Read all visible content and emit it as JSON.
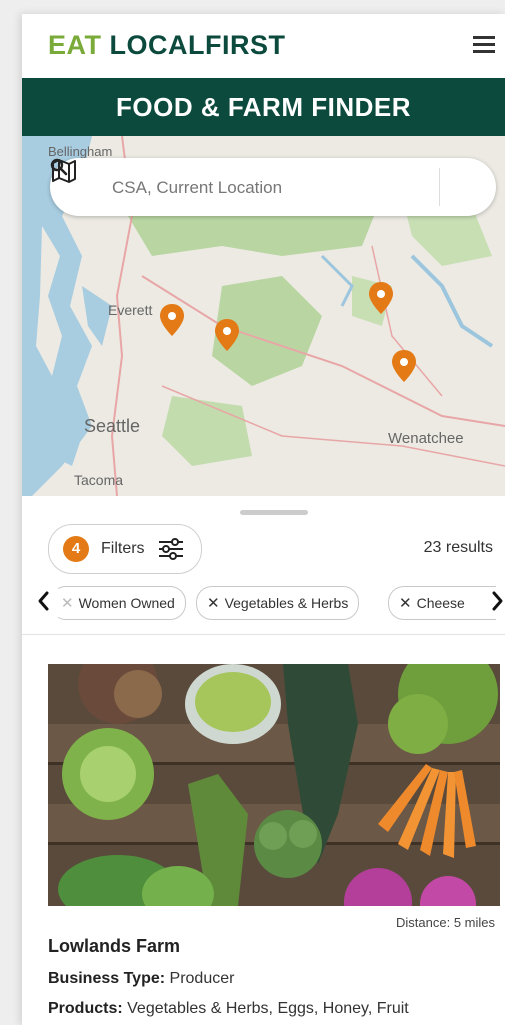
{
  "header": {
    "logo": {
      "eat": "EAT",
      "local": "LOCAL",
      "first": "FIRST"
    },
    "menu_icon": "hamburger-icon",
    "banner_title": "FOOD & FARM FINDER"
  },
  "map": {
    "search_placeholder": "CSA, Current Location",
    "search_icon": "search-icon",
    "map_toggle_icon": "map-icon",
    "place_labels": [
      "Bellingham",
      "Everett",
      "Seattle",
      "Tacoma",
      "Wenatchee"
    ],
    "marker_color": "#e37a16"
  },
  "panel": {
    "filters_count": "4",
    "filters_label": "Filters",
    "results": "23 results",
    "chips": [
      {
        "label": "Women Owned"
      },
      {
        "label": "Vegetables & Herbs"
      },
      {
        "label": "Cheese"
      }
    ]
  },
  "listing": {
    "distance": "Distance: 5 miles",
    "name": "Lowlands Farm",
    "business_type_label": "Business Type:",
    "business_type": "Producer",
    "products_label": "Products:",
    "products": "Vegetables & Herbs, Eggs, Honey, Fruit"
  },
  "colors": {
    "brand_dark": "#0b4a3c",
    "brand_green": "#7aab3a",
    "accent": "#e37a16"
  }
}
